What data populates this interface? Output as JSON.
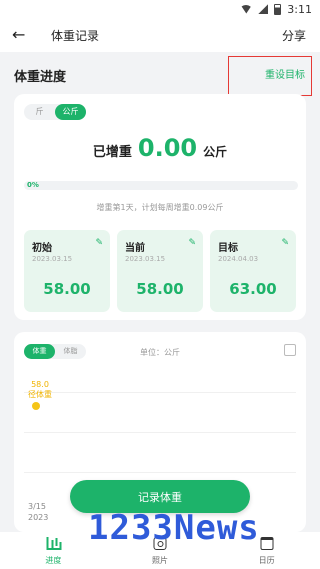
{
  "status_bar": {
    "time": "3:11"
  },
  "app_bar": {
    "back_icon": "arrow-left-icon",
    "title": "体重记录",
    "share_label": "分享"
  },
  "progress_section": {
    "title": "体重进度",
    "reset_link": "重设目标",
    "unit_options": [
      "斤",
      "公斤"
    ],
    "selected_unit": "公斤",
    "gain_label": "已增重",
    "gain_value": "0.00",
    "gain_unit": "公斤",
    "progress_percent": "0%",
    "progress_fraction": 0,
    "plan_text": "增重第1天，计划每周增重0.09公斤",
    "stats": [
      {
        "label": "初始",
        "date": "2023.03.15",
        "value": "58.00",
        "edit_icon": "pencil-icon"
      },
      {
        "label": "当前",
        "date": "2023.03.15",
        "value": "58.00",
        "edit_icon": "pencil-icon"
      },
      {
        "label": "目标",
        "date": "2024.04.03",
        "value": "63.00",
        "edit_icon": "pencil-icon"
      }
    ]
  },
  "chart_section": {
    "tabs": [
      "体重",
      "体脂"
    ],
    "selected_tab": "体重",
    "unit_label": "单位：公斤",
    "expand_icon": "fullscreen-icon",
    "point_value": "58.0",
    "point_label": "径体重",
    "x_label_line1": "3/15",
    "x_label_line2": "2023"
  },
  "chart_data": {
    "type": "line",
    "x": [
      "3/15"
    ],
    "series": [
      {
        "values": [
          58.0
        ]
      }
    ]
  },
  "record_button": "记录体重",
  "tab_bar": [
    {
      "label": "进度",
      "icon": "bar-chart-icon",
      "active": true
    },
    {
      "label": "照片",
      "icon": "camera-icon",
      "active": false
    },
    {
      "label": "日历",
      "icon": "calendar-icon",
      "active": false
    }
  ],
  "watermark": "1233News",
  "colors": {
    "accent": "#1db36a",
    "point": "#f5c518",
    "annotation": "#e53935"
  }
}
